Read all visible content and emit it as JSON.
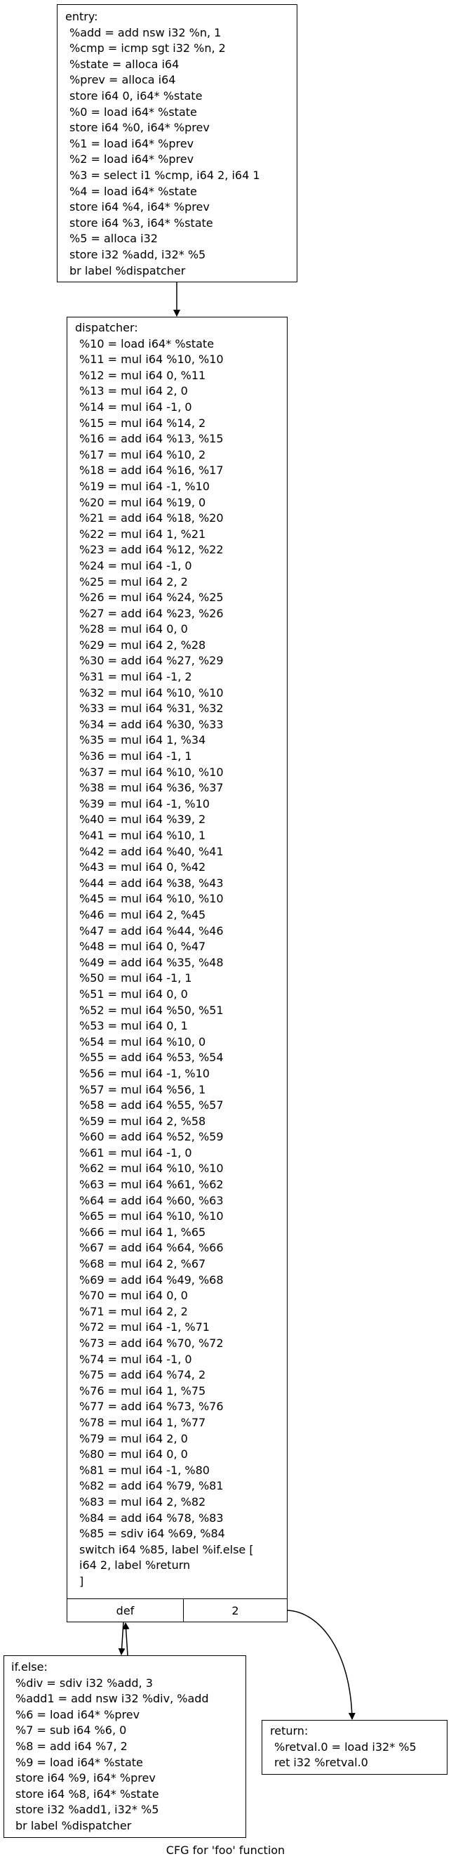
{
  "caption": "CFG for 'foo' function",
  "blocks": {
    "entry": {
      "label": "entry:",
      "lines": [
        "%add = add nsw i32 %n, 1",
        "%cmp = icmp sgt i32 %n, 2",
        "%state = alloca i64",
        "%prev = alloca i64",
        "store i64 0, i64* %state",
        "%0 = load i64* %state",
        "store i64 %0, i64* %prev",
        "%1 = load i64* %prev",
        "%2 = load i64* %prev",
        "%3 = select i1 %cmp, i64 2, i64 1",
        "%4 = load i64* %state",
        "store i64 %4, i64* %prev",
        "store i64 %3, i64* %state",
        "%5 = alloca i32",
        "store i32 %add, i32* %5",
        "br label %dispatcher"
      ]
    },
    "dispatcher": {
      "label": "dispatcher:",
      "lines": [
        "%10 = load i64* %state",
        "%11 = mul i64 %10, %10",
        "%12 = mul i64 0, %11",
        "%13 = mul i64 2, 0",
        "%14 = mul i64 -1, 0",
        "%15 = mul i64 %14, 2",
        "%16 = add i64 %13, %15",
        "%17 = mul i64 %10, 2",
        "%18 = add i64 %16, %17",
        "%19 = mul i64 -1, %10",
        "%20 = mul i64 %19, 0",
        "%21 = add i64 %18, %20",
        "%22 = mul i64 1, %21",
        "%23 = add i64 %12, %22",
        "%24 = mul i64 -1, 0",
        "%25 = mul i64 2, 2",
        "%26 = mul i64 %24, %25",
        "%27 = add i64 %23, %26",
        "%28 = mul i64 0, 0",
        "%29 = mul i64 2, %28",
        "%30 = add i64 %27, %29",
        "%31 = mul i64 -1, 2",
        "%32 = mul i64 %10, %10",
        "%33 = mul i64 %31, %32",
        "%34 = add i64 %30, %33",
        "%35 = mul i64 1, %34",
        "%36 = mul i64 -1, 1",
        "%37 = mul i64 %10, %10",
        "%38 = mul i64 %36, %37",
        "%39 = mul i64 -1, %10",
        "%40 = mul i64 %39, 2",
        "%41 = mul i64 %10, 1",
        "%42 = add i64 %40, %41",
        "%43 = mul i64 0, %42",
        "%44 = add i64 %38, %43",
        "%45 = mul i64 %10, %10",
        "%46 = mul i64 2, %45",
        "%47 = add i64 %44, %46",
        "%48 = mul i64 0, %47",
        "%49 = add i64 %35, %48",
        "%50 = mul i64 -1, 1",
        "%51 = mul i64 0, 0",
        "%52 = mul i64 %50, %51",
        "%53 = mul i64 0, 1",
        "%54 = mul i64 %10, 0",
        "%55 = add i64 %53, %54",
        "%56 = mul i64 -1, %10",
        "%57 = mul i64 %56, 1",
        "%58 = add i64 %55, %57",
        "%59 = mul i64 2, %58",
        "%60 = add i64 %52, %59",
        "%61 = mul i64 -1, 0",
        "%62 = mul i64 %10, %10",
        "%63 = mul i64 %61, %62",
        "%64 = add i64 %60, %63",
        "%65 = mul i64 %10, %10",
        "%66 = mul i64 1, %65",
        "%67 = add i64 %64, %66",
        "%68 = mul i64 2, %67",
        "%69 = add i64 %49, %68",
        "%70 = mul i64 0, 0",
        "%71 = mul i64 2, 2",
        "%72 = mul i64 -1, %71",
        "%73 = add i64 %70, %72",
        "%74 = mul i64 -1, 0",
        "%75 = add i64 %74, 2",
        "%76 = mul i64 1, %75",
        "%77 = add i64 %73, %76",
        "%78 = mul i64 1, %77",
        "%79 = mul i64 2, 0",
        "%80 = mul i64 0, 0",
        "%81 = mul i64 -1, %80",
        "%82 = add i64 %79, %81",
        "%83 = mul i64 2, %82",
        "%84 = add i64 %78, %83",
        "%85 = sdiv i64 %69, %84",
        "switch i64 %85, label %if.else [",
        "i64 2, label %return",
        "]"
      ],
      "ports": [
        "def",
        "2"
      ]
    },
    "if_else": {
      "label": "if.else:",
      "lines": [
        "%div = sdiv i32 %add, 3",
        "%add1 = add nsw i32 %div, %add",
        "%6 = load i64* %prev",
        "%7 = sub i64 %6, 0",
        "%8 = add i64 %7, 2",
        "%9 = load i64* %state",
        "store i64 %9, i64* %prev",
        "store i64 %8, i64* %state",
        "store i32 %add1, i32* %5",
        "br label %dispatcher"
      ]
    },
    "return": {
      "label": "return:",
      "lines": [
        "%retval.0 = load i32* %5",
        "ret i32 %retval.0"
      ]
    }
  }
}
